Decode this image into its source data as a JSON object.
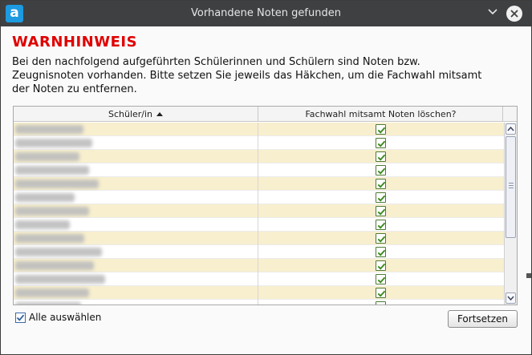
{
  "window": {
    "title": "Vorhandene Noten gefunden"
  },
  "warning": {
    "heading": "WARNHINWEIS",
    "text": "Bei den nachfolgend aufgeführten Schülerinnen und Schülern sind Noten bzw. Zeugnisnoten vorhanden. Bitte setzen Sie jeweils das Häkchen, um die Fachwahl mitsamt der Noten zu entfernen."
  },
  "table": {
    "columns": [
      "Schüler/in",
      "Fachwahl mitsamt Noten löschen?"
    ],
    "sorted_column": "Schüler/in",
    "sort_direction": "ascending",
    "rows": [
      {
        "checked": true
      },
      {
        "checked": true
      },
      {
        "checked": true
      },
      {
        "checked": true
      },
      {
        "checked": true
      },
      {
        "checked": true
      },
      {
        "checked": true
      },
      {
        "checked": true
      },
      {
        "checked": true
      },
      {
        "checked": true
      },
      {
        "checked": true
      },
      {
        "checked": true
      },
      {
        "checked": true
      },
      {
        "checked": true
      }
    ]
  },
  "footer": {
    "select_all_label": "Alle auswählen",
    "select_all_checked": true,
    "continue_label": "Fortsetzen"
  },
  "colors": {
    "warning_red": "#e00000",
    "titlebar": "#3f4042",
    "row_highlight": "#f8efce",
    "check_green": "#3a8a1e"
  },
  "icons": {
    "app": "app-logo-icon",
    "minimize": "chevron-down-icon",
    "close": "close-icon",
    "sort": "sort-ascending-icon",
    "check": "checkmark-icon"
  }
}
